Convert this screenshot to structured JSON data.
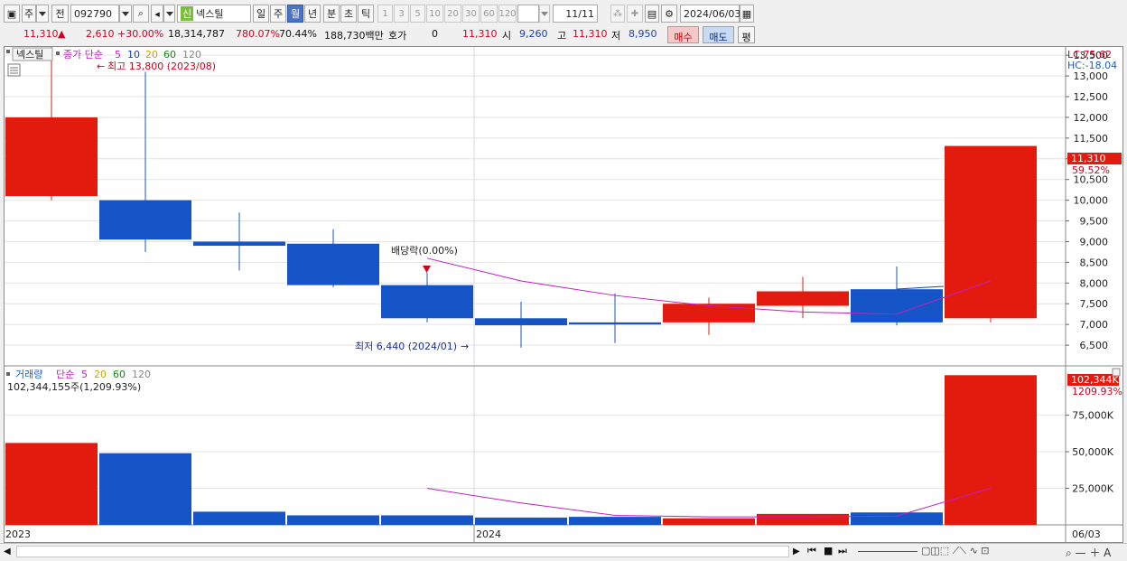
{
  "toolbar": {
    "market": "주",
    "prev": "전",
    "code": "092790",
    "new_badge": "신",
    "stock_name": "넥스틸",
    "periods": [
      "일",
      "주",
      "월",
      "년",
      "분",
      "초",
      "틱"
    ],
    "active_period": "월",
    "intervals": [
      "1",
      "3",
      "5",
      "10",
      "20",
      "30",
      "60",
      "120"
    ],
    "page": "11/11",
    "date": "2024/06/03"
  },
  "quote": {
    "price": "11,310",
    "change": "2,610 +30.00%",
    "volume": "18,314,787",
    "vol_ratio": "780.07%",
    "turnover": "70.44%",
    "amount": "188,730백만",
    "hoga_label": "호가",
    "hoga_value": "0",
    "hoga_price": "11,310",
    "open_label": "시",
    "open": "9,260",
    "high_label": "고",
    "high": "11,310",
    "low_label": "저",
    "low": "8,950",
    "buy": "매수",
    "sell": "매도",
    "avg": "평"
  },
  "price_panel": {
    "name_tag": "넥스틸",
    "ma_label": "종가 단순",
    "ma_periods": [
      {
        "label": "5",
        "color": "#c020c0"
      },
      {
        "label": "10",
        "color": "#1a3fb0"
      },
      {
        "label": "20",
        "color": "#d0a000"
      },
      {
        "label": "60",
        "color": "#108a10"
      },
      {
        "label": "120",
        "color": "#888888"
      }
    ],
    "high_note": "최고 13,800 (2023/08)",
    "low_note": "최저 6,440 (2024/01)",
    "dividend_note": "배당락(0.00%)",
    "lc": "LC:75.62",
    "hc": "HC:-18.04",
    "current_price": "11,310",
    "current_pct": "59.52%"
  },
  "volume_panel": {
    "title": "거래량",
    "ma_label": "단순",
    "ma_periods": [
      {
        "label": "5",
        "color": "#c020c0"
      },
      {
        "label": "20",
        "color": "#d0a000"
      },
      {
        "label": "60",
        "color": "#108a10"
      },
      {
        "label": "120",
        "color": "#888888"
      }
    ],
    "summary": "102,344,155주(1,209.93%)",
    "current_volume": "102,344K",
    "current_pct": "1209.93%"
  },
  "time_axis": {
    "labels": [
      "2023",
      "2024"
    ],
    "right_label": "06/03"
  },
  "chart_data": {
    "type": "candlestick",
    "price_axis": {
      "ticks": [
        6500,
        7000,
        7500,
        8000,
        8500,
        9000,
        9500,
        10000,
        10500,
        11000,
        11500,
        12000,
        12500,
        13000,
        13500
      ],
      "range": [
        6000,
        13700
      ]
    },
    "candles": [
      {
        "open": 10100,
        "high": 13800,
        "low": 10000,
        "close": 12000
      },
      {
        "open": 10000,
        "high": 13100,
        "low": 8750,
        "close": 9050
      },
      {
        "open": 9000,
        "high": 9700,
        "low": 8300,
        "close": 8900
      },
      {
        "open": 8950,
        "high": 9300,
        "low": 7900,
        "close": 7950
      },
      {
        "open": 7950,
        "high": 8250,
        "low": 7050,
        "close": 7150
      },
      {
        "open": 7150,
        "high": 7550,
        "low": 6440,
        "close": 6980
      },
      {
        "open": 7050,
        "high": 7750,
        "low": 6550,
        "close": 7000
      },
      {
        "open": 7050,
        "high": 7650,
        "low": 6750,
        "close": 7500
      },
      {
        "open": 7450,
        "high": 8150,
        "low": 7150,
        "close": 7800
      },
      {
        "open": 7850,
        "high": 8400,
        "low": 6980,
        "close": 7050
      },
      {
        "open": 7150,
        "high": 11300,
        "low": 7050,
        "close": 11310
      }
    ],
    "price_ma5": [
      null,
      null,
      null,
      null,
      8600,
      8050,
      7700,
      7450,
      7300,
      7250,
      8050
    ],
    "volume_axis": {
      "ticks": [
        25000,
        50000,
        75000
      ],
      "tick_labels": [
        "25,000K",
        "50,000K",
        "75,000K"
      ],
      "range": [
        0,
        105000
      ]
    },
    "volumes": [
      56000,
      49000,
      9000,
      6500,
      6500,
      5000,
      5500,
      4500,
      7500,
      8500,
      102344
    ],
    "volume_ma5": [
      null,
      null,
      null,
      null,
      25000,
      15000,
      6500,
      5500,
      5500,
      6000,
      25000
    ]
  }
}
